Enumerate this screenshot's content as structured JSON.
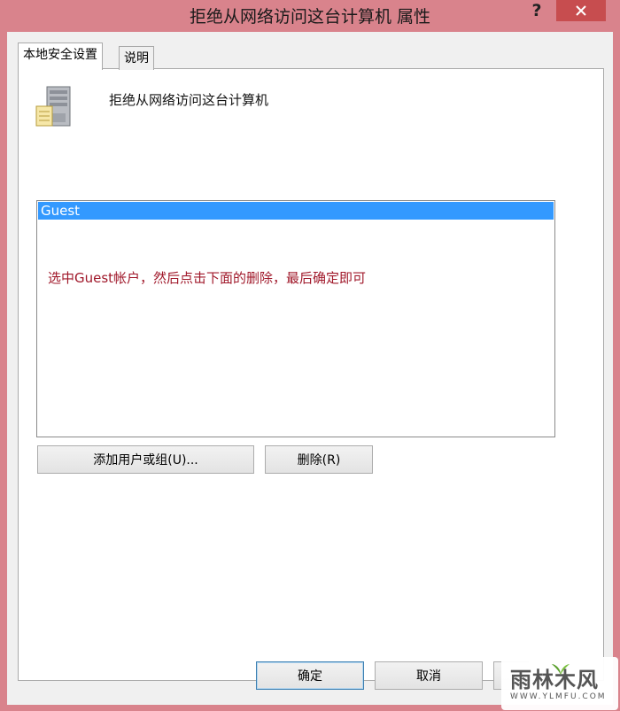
{
  "window": {
    "title": "拒绝从网络访问这台计算机 属性",
    "help_label": "?",
    "close_icon": "close-icon",
    "frame_color": "#d9838c",
    "close_color": "#c74d4f"
  },
  "tabs": [
    {
      "label": "本地安全设置",
      "selected": true
    },
    {
      "label": "说明",
      "selected": false
    }
  ],
  "policy": {
    "icon": "server-icon",
    "title": "拒绝从网络访问这台计算机"
  },
  "user_list": {
    "items": [
      "Guest"
    ],
    "selected_index": 0,
    "selection_color": "#3399ff"
  },
  "annotation": {
    "text": "选中Guest帐户，然后点击下面的删除，最后确定即可",
    "color": "#a0182a"
  },
  "buttons": {
    "add": "添加用户或组(U)...",
    "remove": "删除(R)",
    "ok": "确定",
    "cancel": "取消",
    "apply": ""
  },
  "watermark": {
    "text": "雨林木风",
    "url": "WWW.YLMFU.COM"
  }
}
